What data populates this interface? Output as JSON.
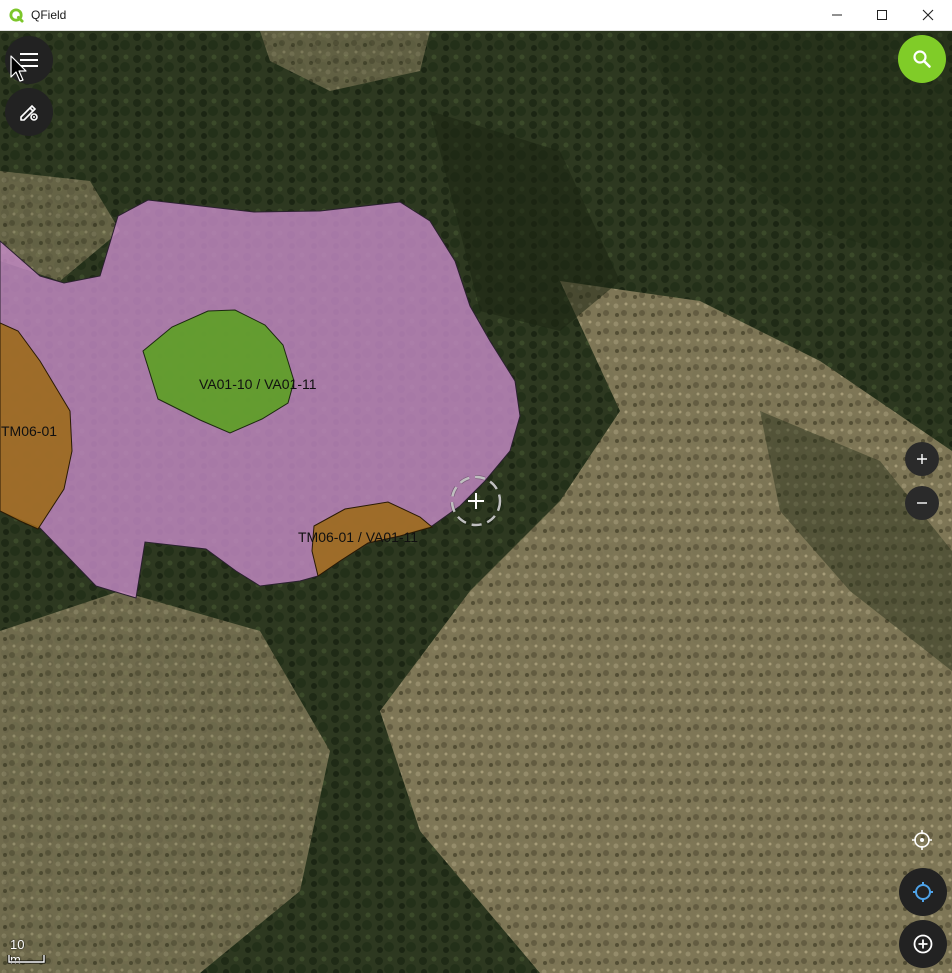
{
  "window": {
    "title": "QField",
    "controls": [
      "minimize-icon",
      "maximize-icon",
      "close-icon"
    ]
  },
  "map": {
    "features": [
      {
        "label": "VA01-10 / VA01-11",
        "color": "#5aa020"
      },
      {
        "label": "TM06-01",
        "color": "#9c6a1c"
      },
      {
        "label": "TM06-01 / VA01-11",
        "color": "#9c6a1c"
      }
    ],
    "zone_color": "#c48ac6",
    "scale_label": "10 m"
  },
  "colors": {
    "accent": "#80cc28",
    "button_dark": "#222222",
    "locate_blue": "#4fa3e8"
  },
  "icons": {
    "menu": "menu-icon",
    "digitize": "pencil-gear-icon",
    "search": "search-icon",
    "zoom_in": "plus-icon",
    "zoom_out": "minus-icon",
    "gnss_crosshair": "crosshair-icon",
    "locate": "location-icon",
    "add": "add-circle-icon"
  }
}
